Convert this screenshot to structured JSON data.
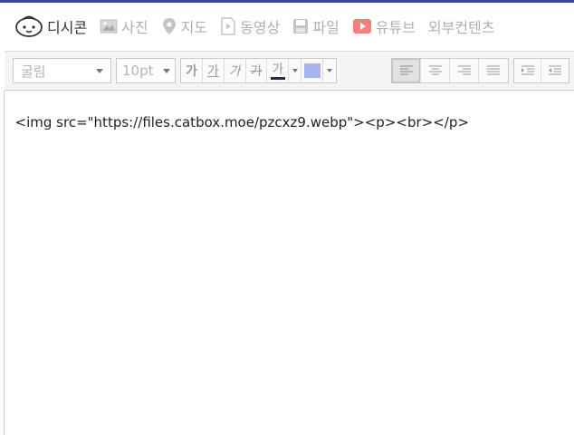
{
  "attach_toolbar": {
    "items": [
      {
        "label": "디시콘",
        "icon": "dccon-face-icon",
        "active": true
      },
      {
        "label": "사진",
        "icon": "photo-icon"
      },
      {
        "label": "지도",
        "icon": "map-pin-icon"
      },
      {
        "label": "동영상",
        "icon": "video-icon"
      },
      {
        "label": "파일",
        "icon": "file-save-icon"
      },
      {
        "label": "유튜브",
        "icon": "youtube-icon"
      },
      {
        "label": "외부컨텐츠",
        "icon": ""
      }
    ]
  },
  "format_toolbar": {
    "font_family": "굴림",
    "font_size": "10pt",
    "bold": "가",
    "underline": "가",
    "italic": "가",
    "strikethrough": "가",
    "font_color": "가",
    "font_color_swatch": "#1f2a5a",
    "bg_color_swatch": "#a8b4ee"
  },
  "editor": {
    "content": "<img src=\"https://files.catbox.moe/pzcxz9.webp\"><p><br></p>"
  },
  "colors": {
    "accent": "#3b4890"
  }
}
